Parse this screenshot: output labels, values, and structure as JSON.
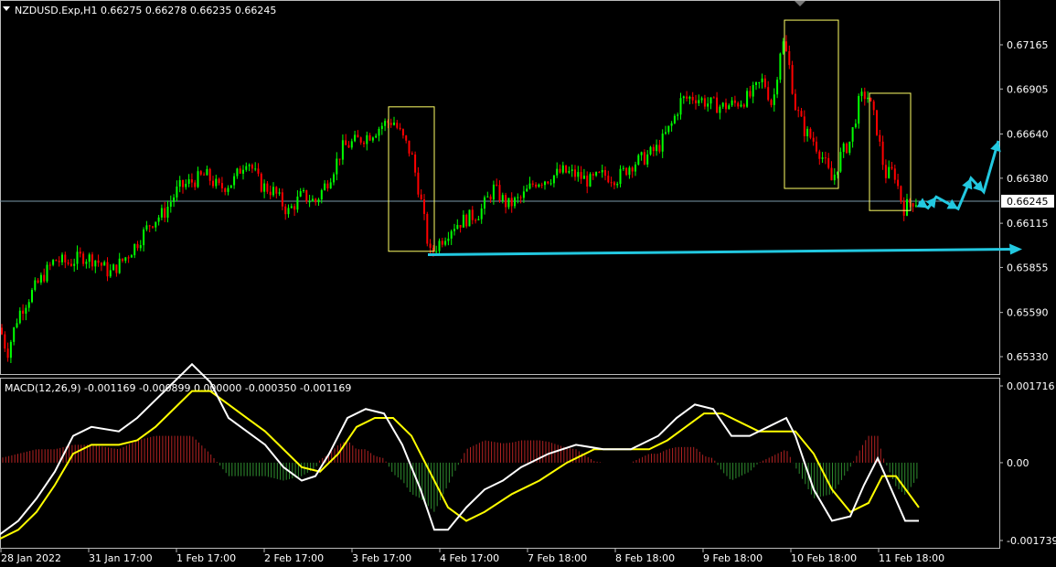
{
  "header": {
    "symbol_line": "NZDUSD.Exp,H1  0.66275 0.66278 0.66235 0.66245"
  },
  "indicator": {
    "label": "MACD(12,26,9) -0.001169 -0.000899 0.000000 -0.000350 -0.001169"
  },
  "price_axis": {
    "ticks": [
      "0.67165",
      "0.66905",
      "0.66640",
      "0.66380",
      "0.66115",
      "0.65855",
      "0.65590",
      "0.65330"
    ],
    "current_price": "0.66245"
  },
  "macd_axis": {
    "ticks": [
      "0.001716",
      "0.00",
      "-0.001739"
    ]
  },
  "time_axis": {
    "ticks": [
      "28 Jan 2022",
      "31 Jan 17:00",
      "1 Feb 17:00",
      "2 Feb 17:00",
      "3 Feb 17:00",
      "4 Feb 17:00",
      "7 Feb 18:00",
      "8 Feb 18:00",
      "9 Feb 18:00",
      "10 Feb 18:00",
      "11 Feb 18:00"
    ]
  },
  "colors": {
    "background": "#000000",
    "bull": "#00ff00",
    "bear": "#ff0000",
    "box": "#ffff66",
    "arrow": "#22c8e0",
    "macd_main": "#ffffff",
    "macd_signal": "#ffff00",
    "hist_pos": "#b22222",
    "hist_neg": "#2e8b2e"
  },
  "chart_data": {
    "type": "candlestick",
    "symbol": "NZDUSD.Exp",
    "timeframe": "H1",
    "price_range": [
      0.6525,
      0.6733
    ],
    "close_path": [
      [
        0,
        0.655
      ],
      [
        8,
        0.6535
      ],
      [
        20,
        0.6558
      ],
      [
        40,
        0.6575
      ],
      [
        60,
        0.659
      ],
      [
        75,
        0.6588
      ],
      [
        90,
        0.6592
      ],
      [
        105,
        0.659
      ],
      [
        120,
        0.6582
      ],
      [
        135,
        0.659
      ],
      [
        150,
        0.66
      ],
      [
        165,
        0.6612
      ],
      [
        180,
        0.6618
      ],
      [
        195,
        0.6632
      ],
      [
        210,
        0.6636
      ],
      [
        225,
        0.664
      ],
      [
        240,
        0.6632
      ],
      [
        255,
        0.6636
      ],
      [
        270,
        0.665
      ],
      [
        285,
        0.6634
      ],
      [
        300,
        0.663
      ],
      [
        315,
        0.6618
      ],
      [
        330,
        0.6628
      ],
      [
        345,
        0.6624
      ],
      [
        360,
        0.6638
      ],
      [
        375,
        0.6656
      ],
      [
        390,
        0.666
      ],
      [
        405,
        0.6664
      ],
      [
        420,
        0.667
      ],
      [
        430,
        0.6672
      ],
      [
        440,
        0.6662
      ],
      [
        450,
        0.6652
      ],
      [
        460,
        0.6626
      ],
      [
        470,
        0.6593
      ],
      [
        480,
        0.66
      ],
      [
        495,
        0.661
      ],
      [
        510,
        0.6614
      ],
      [
        525,
        0.6618
      ],
      [
        540,
        0.6632
      ],
      [
        555,
        0.6622
      ],
      [
        570,
        0.6626
      ],
      [
        585,
        0.6636
      ],
      [
        600,
        0.6638
      ],
      [
        615,
        0.6642
      ],
      [
        630,
        0.664
      ],
      [
        645,
        0.6636
      ],
      [
        660,
        0.664
      ],
      [
        675,
        0.6638
      ],
      [
        690,
        0.6646
      ],
      [
        705,
        0.665
      ],
      [
        720,
        0.6656
      ],
      [
        735,
        0.667
      ],
      [
        745,
        0.6684
      ],
      [
        760,
        0.6686
      ],
      [
        775,
        0.6682
      ],
      [
        790,
        0.668
      ],
      [
        805,
        0.6682
      ],
      [
        820,
        0.6686
      ],
      [
        835,
        0.6696
      ],
      [
        845,
        0.668
      ],
      [
        855,
        0.672
      ],
      [
        862,
        0.6708
      ],
      [
        870,
        0.668
      ],
      [
        880,
        0.6666
      ],
      [
        890,
        0.666
      ],
      [
        900,
        0.665
      ],
      [
        910,
        0.6636
      ],
      [
        920,
        0.6652
      ],
      [
        930,
        0.666
      ],
      [
        940,
        0.6684
      ],
      [
        948,
        0.6688
      ],
      [
        958,
        0.667
      ],
      [
        968,
        0.664
      ],
      [
        978,
        0.6642
      ],
      [
        988,
        0.662
      ],
      [
        998,
        0.6625
      ],
      [
        1005,
        0.6624
      ]
    ],
    "projection": [
      [
        1005,
        0.6624
      ],
      [
        1015,
        0.66205
      ],
      [
        1024,
        0.6627
      ],
      [
        1048,
        0.662
      ],
      [
        1062,
        0.6638
      ],
      [
        1076,
        0.663
      ],
      [
        1092,
        0.666
      ]
    ],
    "support_level": 0.6593,
    "highlight_boxes": [
      {
        "x": [
          425,
          475
        ],
        "price": [
          0.6595,
          0.668
        ]
      },
      {
        "x": [
          858,
          917
        ],
        "price": [
          0.6632,
          0.6731
        ]
      },
      {
        "x": [
          951,
          996
        ],
        "price": [
          0.6619,
          0.6688
        ]
      }
    ],
    "macd": {
      "range": [
        -0.001739,
        0.001716
      ],
      "main": [
        [
          0,
          -0.0016
        ],
        [
          20,
          -0.0013
        ],
        [
          40,
          -0.0008
        ],
        [
          60,
          -0.0002
        ],
        [
          80,
          0.0006
        ],
        [
          100,
          0.0008
        ],
        [
          130,
          0.0007
        ],
        [
          150,
          0.001
        ],
        [
          170,
          0.0014
        ],
        [
          190,
          0.0018
        ],
        [
          210,
          0.0022
        ],
        [
          230,
          0.0018
        ],
        [
          250,
          0.001
        ],
        [
          270,
          0.0007
        ],
        [
          290,
          0.0004
        ],
        [
          310,
          -0.0001
        ],
        [
          330,
          -0.0004
        ],
        [
          345,
          -0.0003
        ],
        [
          360,
          0.0002
        ],
        [
          380,
          0.001
        ],
        [
          400,
          0.0012
        ],
        [
          420,
          0.0011
        ],
        [
          440,
          0.0004
        ],
        [
          460,
          -0.0006
        ],
        [
          475,
          -0.0015
        ],
        [
          490,
          -0.0015
        ],
        [
          510,
          -0.001
        ],
        [
          530,
          -0.0006
        ],
        [
          550,
          -0.0004
        ],
        [
          570,
          -0.0001
        ],
        [
          600,
          0.0002
        ],
        [
          630,
          0.0004
        ],
        [
          660,
          0.0003
        ],
        [
          690,
          0.0003
        ],
        [
          720,
          0.0006
        ],
        [
          740,
          0.001
        ],
        [
          760,
          0.0013
        ],
        [
          780,
          0.0012
        ],
        [
          800,
          0.0006
        ],
        [
          820,
          0.0006
        ],
        [
          840,
          0.0008
        ],
        [
          860,
          0.001
        ],
        [
          870,
          0.0006
        ],
        [
          890,
          -0.0006
        ],
        [
          910,
          -0.0013
        ],
        [
          930,
          -0.0012
        ],
        [
          945,
          -0.0005
        ],
        [
          960,
          0.0001
        ],
        [
          975,
          -0.0006
        ],
        [
          990,
          -0.0013
        ],
        [
          1005,
          -0.0013
        ]
      ],
      "signal": [
        [
          0,
          -0.0017
        ],
        [
          20,
          -0.0015
        ],
        [
          40,
          -0.0011
        ],
        [
          60,
          -0.0005
        ],
        [
          80,
          0.0002
        ],
        [
          100,
          0.0004
        ],
        [
          130,
          0.0004
        ],
        [
          150,
          0.0005
        ],
        [
          170,
          0.0008
        ],
        [
          190,
          0.0012
        ],
        [
          210,
          0.0016
        ],
        [
          230,
          0.0016
        ],
        [
          250,
          0.0013
        ],
        [
          270,
          0.001
        ],
        [
          290,
          0.0007
        ],
        [
          310,
          0.0003
        ],
        [
          330,
          -0.0001
        ],
        [
          350,
          -0.0002
        ],
        [
          370,
          0.0002
        ],
        [
          390,
          0.0008
        ],
        [
          410,
          0.001
        ],
        [
          430,
          0.001
        ],
        [
          450,
          0.0006
        ],
        [
          470,
          -0.0002
        ],
        [
          490,
          -0.001
        ],
        [
          510,
          -0.0013
        ],
        [
          530,
          -0.0011
        ],
        [
          560,
          -0.0007
        ],
        [
          590,
          -0.0004
        ],
        [
          620,
          0.0
        ],
        [
          650,
          0.0003
        ],
        [
          680,
          0.0003
        ],
        [
          710,
          0.0003
        ],
        [
          730,
          0.0005
        ],
        [
          750,
          0.0008
        ],
        [
          770,
          0.0011
        ],
        [
          790,
          0.0011
        ],
        [
          810,
          0.0009
        ],
        [
          830,
          0.0007
        ],
        [
          850,
          0.0007
        ],
        [
          870,
          0.0007
        ],
        [
          890,
          0.0002
        ],
        [
          910,
          -0.0006
        ],
        [
          930,
          -0.0011
        ],
        [
          950,
          -0.0009
        ],
        [
          965,
          -0.0003
        ],
        [
          980,
          -0.0003
        ],
        [
          1005,
          -0.001
        ]
      ]
    }
  }
}
